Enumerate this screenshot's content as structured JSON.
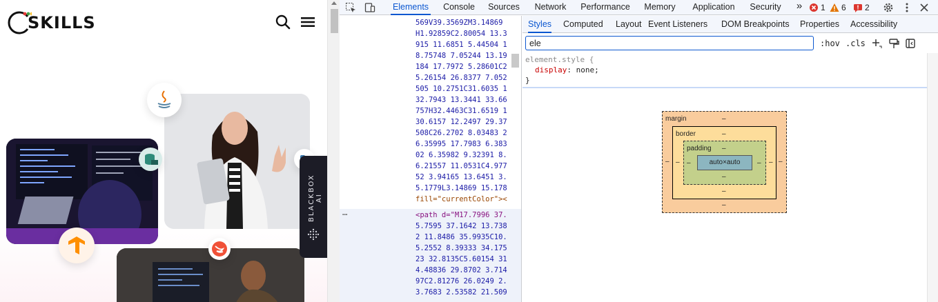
{
  "site": {
    "logo_text": "SKILLS",
    "blackbox_label": "BLACKBOX AI"
  },
  "devtools": {
    "tabs": [
      "Elements",
      "Console",
      "Sources",
      "Network",
      "Performance",
      "Memory",
      "Application",
      "Security"
    ],
    "active_tab": "Elements",
    "more_tabs": "»",
    "errors_count": "1",
    "warnings_count": "6",
    "issues_count": "2",
    "code_lines": [
      "569V39.3569ZM3.14869",
      "H1.92859C2.80054 13.3",
      "915 11.6851 5.44504 1",
      "8.75748 7.05244 13.19",
      "184 17.7972 5.28601C2",
      "5.26154 26.8377 7.052",
      "505 10.2751C31.6035 1",
      "32.7943 13.3441 33.66",
      "757H32.4463C31.6519 1",
      "30.6157 12.2497 29.37",
      "508C26.2702 8.03483 2",
      "6.35995 17.7983 6.383",
      "02 6.35982 9.32391 8.",
      "6.21557 11.0531C4.977",
      "52 3.94165 13.6451 3.",
      "5.1779L3.14869 15.178",
      "fill=\"currentColor\"><",
      "<path d=\"M17.7996 37.",
      "5.7595 37.1642 13.738",
      "2 11.8486 35.9935C10.",
      "5.2552 8.39333 34.175",
      "23 32.8135C5.60154 31",
      "4.48836 29.8702 3.714",
      "97C2.81276 26.0249 2.",
      "3.7683 2.53582 21.509"
    ],
    "ellipsis": "⋯",
    "subtabs": [
      "Styles",
      "Computed",
      "Layout",
      "Event Listeners",
      "DOM Breakpoints",
      "Properties",
      "Accessibility"
    ],
    "active_subtab": "Styles",
    "filter_value": "ele",
    "hov_label": ":hov",
    "cls_label": ".cls",
    "rule": {
      "selector": "element.style {",
      "property": "display",
      "value": "none;",
      "close": "}"
    },
    "box_model": {
      "margin_label": "margin",
      "border_label": "border",
      "padding_label": "padding",
      "content": "auto×auto",
      "dash": "–"
    }
  },
  "colors": {
    "accent": "#0b57d0",
    "error": "#dc362e",
    "warning": "#e37400"
  }
}
